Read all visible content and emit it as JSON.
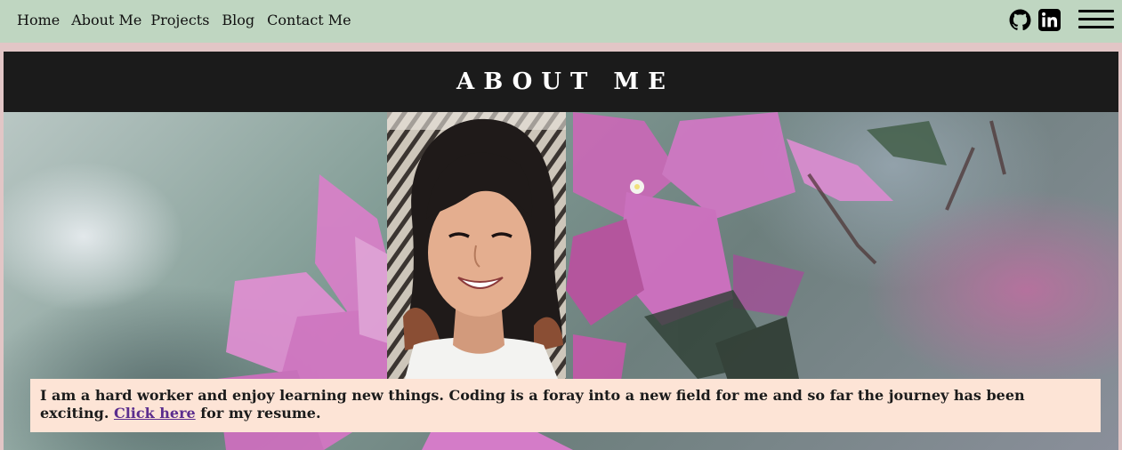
{
  "nav": {
    "links": [
      "Home",
      "About Me",
      "Projects",
      "Blog",
      "Contact Me"
    ]
  },
  "social": {
    "github_icon": "github-icon",
    "linkedin_icon": "linkedin-icon",
    "menu_icon": "hamburger-menu-icon"
  },
  "section": {
    "title": "ABOUT ME"
  },
  "intro": {
    "text_before": "I am a hard worker and enjoy learning new things. Coding is a foray into a new field for me and so far the journey has been exciting. ",
    "link_label": "Click here",
    "text_after": " for my resume."
  },
  "colors": {
    "navbar_bg": "#bfd6c1",
    "page_bg": "#e2c6c6",
    "header_bg": "#1b1b1b",
    "card_bg": "#fde4d6",
    "link": "#5b2d8e",
    "flower": "#d877c8"
  }
}
